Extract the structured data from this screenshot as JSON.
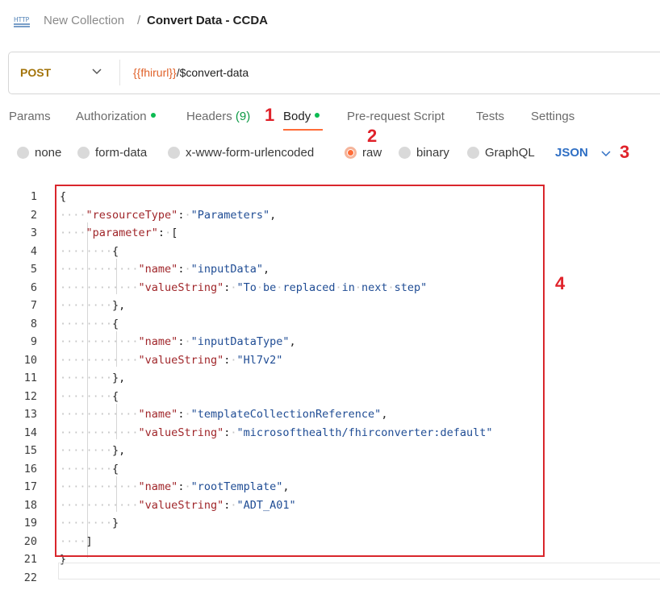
{
  "breadcrumb": {
    "icon_name": "http-icon",
    "icon_text": "HTTP",
    "parent": "New Collection",
    "separator": "/",
    "current": "Convert Data - CCDA"
  },
  "request": {
    "method": "POST",
    "url_variable": "{{fhirurl}}",
    "url_path": "/$convert-data"
  },
  "tabs": [
    {
      "label": "Params"
    },
    {
      "label": "Authorization",
      "indicator": true
    },
    {
      "label": "Headers",
      "count": "(9)"
    },
    {
      "label": "Body",
      "indicator": true,
      "active": true
    },
    {
      "label": "Pre-request Script"
    },
    {
      "label": "Tests"
    },
    {
      "label": "Settings"
    }
  ],
  "body_types": [
    {
      "label": "none",
      "selected": false
    },
    {
      "label": "form-data",
      "selected": false
    },
    {
      "label": "x-www-form-urlencoded",
      "selected": false
    },
    {
      "label": "raw",
      "selected": true
    },
    {
      "label": "binary",
      "selected": false
    },
    {
      "label": "GraphQL",
      "selected": false
    }
  ],
  "raw_format": "JSON",
  "annotations": [
    "1",
    "2",
    "3",
    "4"
  ],
  "editor": {
    "line_numbers": [
      "1",
      "2",
      "3",
      "4",
      "5",
      "6",
      "7",
      "8",
      "9",
      "10",
      "11",
      "12",
      "13",
      "14",
      "15",
      "16",
      "17",
      "18",
      "19",
      "20",
      "21",
      "22"
    ],
    "lines": [
      "{",
      "    \"resourceType\": \"Parameters\",",
      "    \"parameter\": [",
      "        {",
      "            \"name\": \"inputData\",",
      "            \"valueString\": \"To be replaced in next step\"",
      "        },",
      "        {",
      "            \"name\": \"inputDataType\",",
      "            \"valueString\": \"Hl7v2\"",
      "        },",
      "        {",
      "            \"name\": \"templateCollectionReference\",",
      "            \"valueString\": \"microsofthealth/fhirconverter:default\"",
      "        },",
      "        {",
      "            \"name\": \"rootTemplate\",",
      "            \"valueString\": \"ADT_A01\"",
      "        }",
      "    ]",
      "}",
      ""
    ]
  },
  "colors": {
    "accent": "#ff6c37",
    "method": "#a3740b",
    "url_variable": "#e0622a",
    "json_key": "#a0262a",
    "json_string": "#1f4c94",
    "annotation": "#e0222a",
    "status_dot": "#0cbb52"
  }
}
